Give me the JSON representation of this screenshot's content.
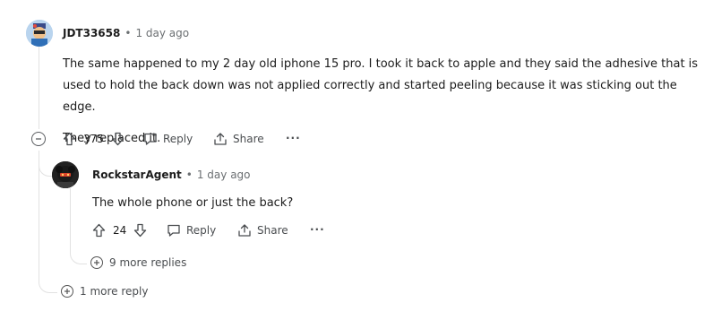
{
  "comment": {
    "username": "JDT33658",
    "time_sep": "•",
    "time": "1 day ago",
    "paragraphs": [
      "The same happened to my 2 day old iphone 15 pro. I took it back to apple and they said the adhesive that is",
      "used to hold the back down was not applied correctly and started peeling because it was sticking out the edge.",
      "They replaced it."
    ],
    "votes": "375",
    "reply_label": "Reply",
    "share_label": "Share",
    "more_label": "···"
  },
  "reply": {
    "username": "RockstarAgent",
    "time_sep": "•",
    "time": "1 day ago",
    "text": "The whole phone or just the back?",
    "votes": "24",
    "reply_label": "Reply",
    "share_label": "Share",
    "more_label": "···",
    "more_replies": "9 more replies"
  },
  "more_reply": "1 more reply",
  "colors": {
    "line": "#e2e2e2",
    "text": "#1c1c1c",
    "muted": "#6b6f72"
  },
  "icons": [
    "collapse-icon",
    "upvote-icon",
    "downvote-icon",
    "reply-icon",
    "share-icon",
    "more-icon",
    "expand-icon"
  ]
}
